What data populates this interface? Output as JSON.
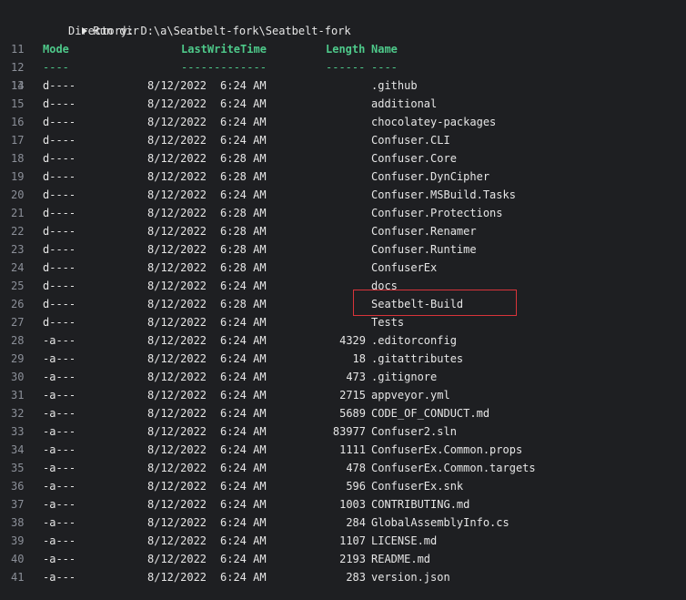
{
  "run": {
    "line": "",
    "title": "Run dir",
    "directory_line_no": "11",
    "directory_text": "Directory: D:\\a\\Seatbelt-fork\\Seatbelt-fork"
  },
  "header": {
    "line": "12",
    "mode": "Mode",
    "last_write_time": "LastWriteTime",
    "length": "Length",
    "name": "Name"
  },
  "separator": {
    "line": "13",
    "mode": "----",
    "last_write_time": "-------------",
    "length": "------",
    "name": "----"
  },
  "rows": [
    {
      "line": "14",
      "mode": "d----",
      "date": "8/12/2022",
      "time": "6:24 AM",
      "length": "",
      "name": ".github"
    },
    {
      "line": "15",
      "mode": "d----",
      "date": "8/12/2022",
      "time": "6:24 AM",
      "length": "",
      "name": "additional"
    },
    {
      "line": "16",
      "mode": "d----",
      "date": "8/12/2022",
      "time": "6:24 AM",
      "length": "",
      "name": "chocolatey-packages"
    },
    {
      "line": "17",
      "mode": "d----",
      "date": "8/12/2022",
      "time": "6:24 AM",
      "length": "",
      "name": "Confuser.CLI"
    },
    {
      "line": "18",
      "mode": "d----",
      "date": "8/12/2022",
      "time": "6:28 AM",
      "length": "",
      "name": "Confuser.Core"
    },
    {
      "line": "19",
      "mode": "d----",
      "date": "8/12/2022",
      "time": "6:28 AM",
      "length": "",
      "name": "Confuser.DynCipher"
    },
    {
      "line": "20",
      "mode": "d----",
      "date": "8/12/2022",
      "time": "6:24 AM",
      "length": "",
      "name": "Confuser.MSBuild.Tasks"
    },
    {
      "line": "21",
      "mode": "d----",
      "date": "8/12/2022",
      "time": "6:28 AM",
      "length": "",
      "name": "Confuser.Protections"
    },
    {
      "line": "22",
      "mode": "d----",
      "date": "8/12/2022",
      "time": "6:28 AM",
      "length": "",
      "name": "Confuser.Renamer"
    },
    {
      "line": "23",
      "mode": "d----",
      "date": "8/12/2022",
      "time": "6:28 AM",
      "length": "",
      "name": "Confuser.Runtime"
    },
    {
      "line": "24",
      "mode": "d----",
      "date": "8/12/2022",
      "time": "6:28 AM",
      "length": "",
      "name": "ConfuserEx"
    },
    {
      "line": "25",
      "mode": "d----",
      "date": "8/12/2022",
      "time": "6:24 AM",
      "length": "",
      "name": "docs"
    },
    {
      "line": "26",
      "mode": "d----",
      "date": "8/12/2022",
      "time": "6:28 AM",
      "length": "",
      "name": "Seatbelt-Build"
    },
    {
      "line": "27",
      "mode": "d----",
      "date": "8/12/2022",
      "time": "6:24 AM",
      "length": "",
      "name": "Tests"
    },
    {
      "line": "28",
      "mode": "-a---",
      "date": "8/12/2022",
      "time": "6:24 AM",
      "length": "4329",
      "name": ".editorconfig"
    },
    {
      "line": "29",
      "mode": "-a---",
      "date": "8/12/2022",
      "time": "6:24 AM",
      "length": "18",
      "name": ".gitattributes"
    },
    {
      "line": "30",
      "mode": "-a---",
      "date": "8/12/2022",
      "time": "6:24 AM",
      "length": "473",
      "name": ".gitignore"
    },
    {
      "line": "31",
      "mode": "-a---",
      "date": "8/12/2022",
      "time": "6:24 AM",
      "length": "2715",
      "name": "appveyor.yml"
    },
    {
      "line": "32",
      "mode": "-a---",
      "date": "8/12/2022",
      "time": "6:24 AM",
      "length": "5689",
      "name": "CODE_OF_CONDUCT.md"
    },
    {
      "line": "33",
      "mode": "-a---",
      "date": "8/12/2022",
      "time": "6:24 AM",
      "length": "83977",
      "name": "Confuser2.sln"
    },
    {
      "line": "34",
      "mode": "-a---",
      "date": "8/12/2022",
      "time": "6:24 AM",
      "length": "1111",
      "name": "ConfuserEx.Common.props"
    },
    {
      "line": "35",
      "mode": "-a---",
      "date": "8/12/2022",
      "time": "6:24 AM",
      "length": "478",
      "name": "ConfuserEx.Common.targets"
    },
    {
      "line": "36",
      "mode": "-a---",
      "date": "8/12/2022",
      "time": "6:24 AM",
      "length": "596",
      "name": "ConfuserEx.snk"
    },
    {
      "line": "37",
      "mode": "-a---",
      "date": "8/12/2022",
      "time": "6:24 AM",
      "length": "1003",
      "name": "CONTRIBUTING.md"
    },
    {
      "line": "38",
      "mode": "-a---",
      "date": "8/12/2022",
      "time": "6:24 AM",
      "length": "284",
      "name": "GlobalAssemblyInfo.cs"
    },
    {
      "line": "39",
      "mode": "-a---",
      "date": "8/12/2022",
      "time": "6:24 AM",
      "length": "1107",
      "name": "LICENSE.md"
    },
    {
      "line": "40",
      "mode": "-a---",
      "date": "8/12/2022",
      "time": "6:24 AM",
      "length": "2193",
      "name": "README.md"
    },
    {
      "line": "41",
      "mode": "-a---",
      "date": "8/12/2022",
      "time": "6:24 AM",
      "length": "283",
      "name": "version.json"
    }
  ],
  "colors": {
    "background": "#1e1f22",
    "header_green": "#4ec98a",
    "highlight_red": "#d8343a",
    "line_number": "#8b8f98"
  }
}
